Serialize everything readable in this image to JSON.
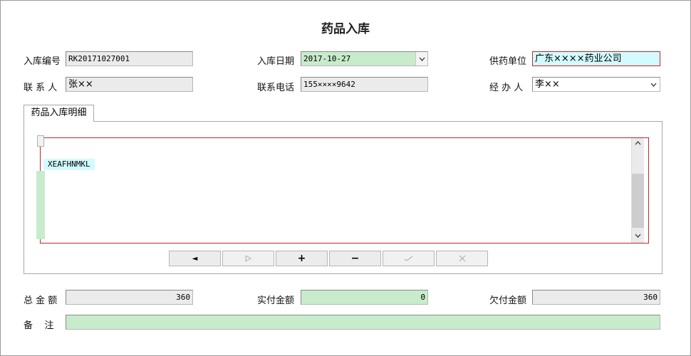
{
  "title": "药品入库",
  "form": {
    "receipt_no": {
      "label": "入库编号",
      "value": "RK20171027001"
    },
    "receipt_date": {
      "label": "入库日期",
      "value": "2017-10-27"
    },
    "supplier": {
      "label": "供药单位",
      "value": "广东××××药业公司"
    },
    "contact": {
      "label": "联 系 人",
      "value": "张××"
    },
    "phone": {
      "label": "联系电话",
      "value": "155××××9642"
    },
    "handler": {
      "label": "经 办 人",
      "value": "李××"
    }
  },
  "tab": {
    "label": "药品入库明细"
  },
  "grid": {
    "row_text": "XEAFHNMKL"
  },
  "navigator": {
    "prior": "◄",
    "insert": "+",
    "delete": "−"
  },
  "totals": {
    "total": {
      "label": "总 金 额",
      "value": "360"
    },
    "paid": {
      "label": "实付金额",
      "value": "0"
    },
    "owed": {
      "label": "欠付金额",
      "value": "360"
    }
  },
  "remark": {
    "label": "备    注",
    "value": ""
  },
  "colors": {
    "edit_green": "#c8ebcc",
    "focus_cyan": "#d3fbff",
    "focus_border": "#c0282a"
  }
}
